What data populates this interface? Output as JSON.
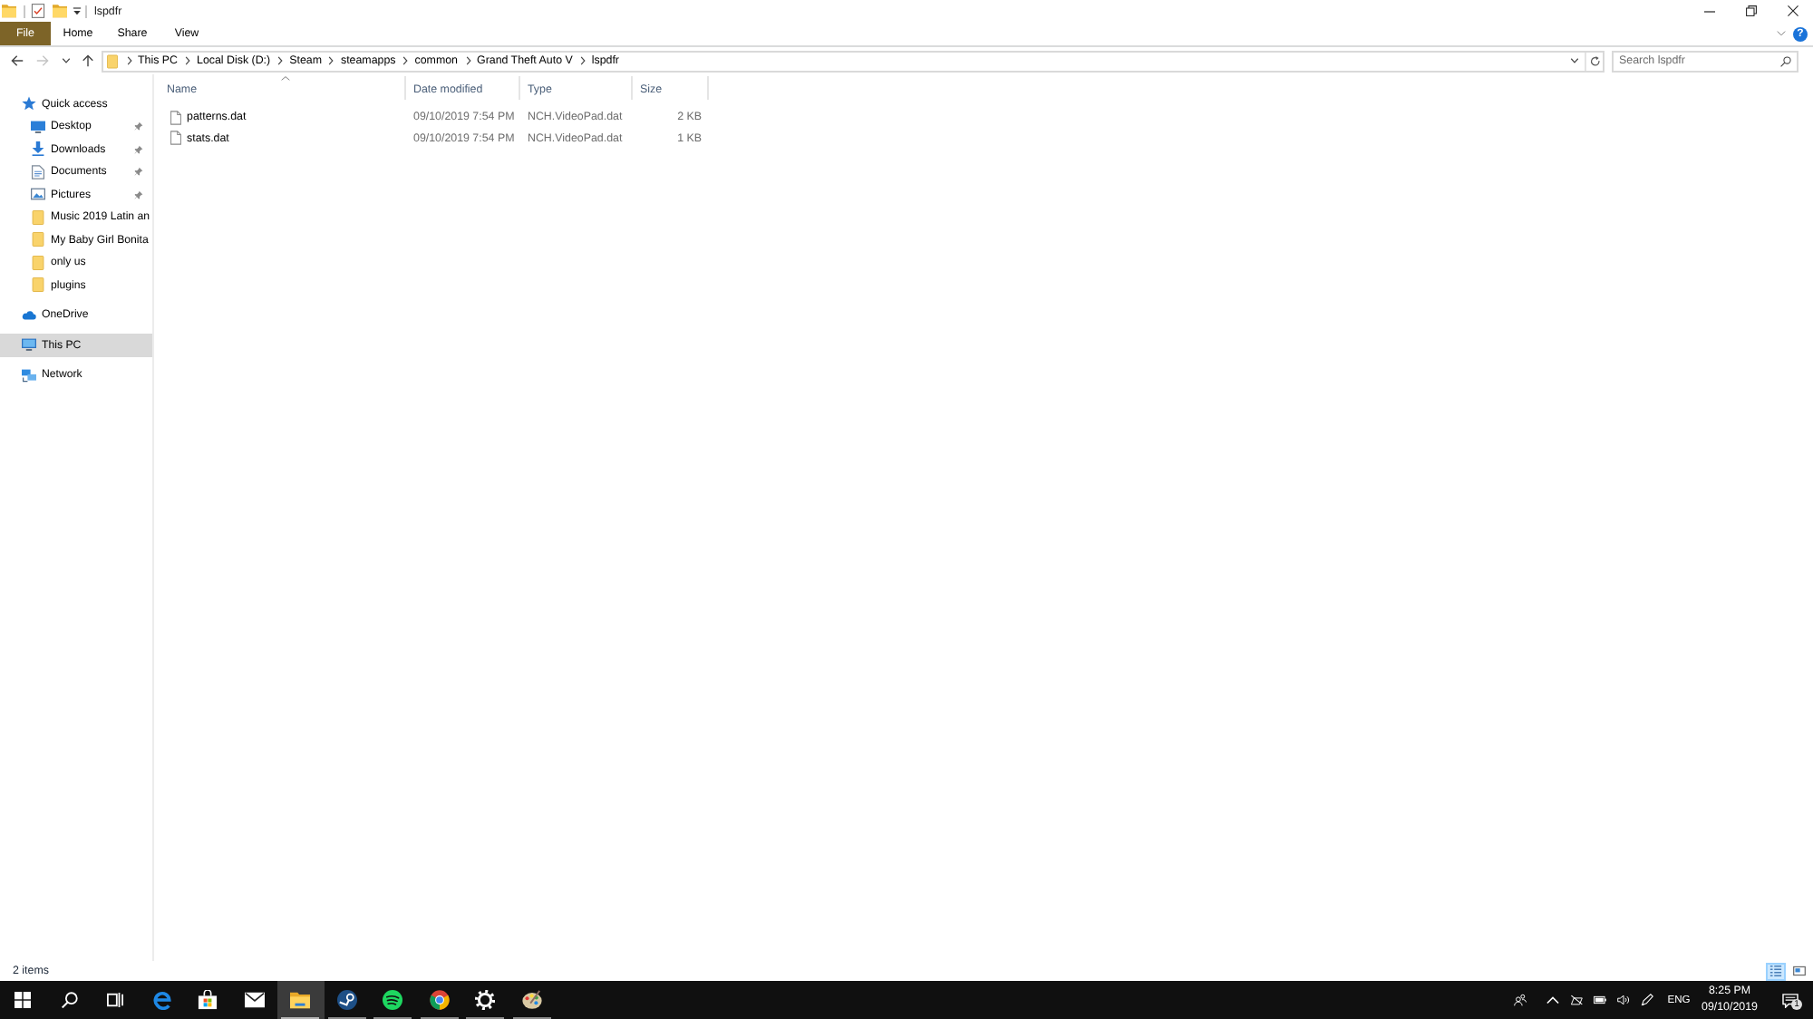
{
  "title_bar": {
    "title": "lspdfr"
  },
  "ribbon": {
    "tabs": [
      {
        "label": "File",
        "kind": "file",
        "selected": false
      },
      {
        "label": "Home",
        "kind": "tab",
        "selected": false
      },
      {
        "label": "Share",
        "kind": "tab",
        "selected": false
      },
      {
        "label": "View",
        "kind": "tab",
        "selected": false
      }
    ],
    "help": "?"
  },
  "navigation": {
    "buttons": [
      {
        "kind": "back",
        "disabled": false
      },
      {
        "kind": "forward",
        "disabled": true
      },
      {
        "kind": "recent",
        "disabled": false
      },
      {
        "kind": "up",
        "disabled": false
      }
    ]
  },
  "address_bar": {
    "path": [
      "This PC",
      "Local Disk (D:)",
      "Steam",
      "steamapps",
      "common",
      "Grand Theft Auto V",
      "lspdfr"
    ]
  },
  "search": {
    "placeholder": "Search lspdfr"
  },
  "navigation_pane": {
    "items": [
      {
        "label": "Quick access",
        "kind": "quick-access",
        "pinned": false,
        "selected": false,
        "children": [
          {
            "label": "Desktop",
            "kind": "desktop",
            "pinned": true,
            "selected": false
          },
          {
            "label": "Downloads",
            "kind": "downloads",
            "pinned": true,
            "selected": false
          },
          {
            "label": "Documents",
            "kind": "documents",
            "pinned": true,
            "selected": false
          },
          {
            "label": "Pictures",
            "kind": "pictures",
            "pinned": true,
            "selected": false
          },
          {
            "label": "Music 2019 Latin an",
            "kind": "folder",
            "pinned": false,
            "selected": false
          },
          {
            "label": "My Baby Girl Bonita",
            "kind": "folder",
            "pinned": false,
            "selected": false
          },
          {
            "label": "only us",
            "kind": "folder",
            "pinned": false,
            "selected": false
          },
          {
            "label": "plugins",
            "kind": "folder",
            "pinned": false,
            "selected": false
          }
        ]
      },
      {
        "label": "OneDrive",
        "kind": "onedrive",
        "pinned": false,
        "selected": false
      },
      {
        "label": "This PC",
        "kind": "this-pc",
        "pinned": false,
        "selected": true
      },
      {
        "label": "Network",
        "kind": "network",
        "pinned": false,
        "selected": false
      }
    ]
  },
  "file_list": {
    "columns": [
      {
        "label": "Name",
        "sorted": true
      },
      {
        "label": "Date modified",
        "sorted": false
      },
      {
        "label": "Type",
        "sorted": false
      },
      {
        "label": "Size",
        "sorted": false
      }
    ],
    "rows": [
      {
        "name": "patterns.dat",
        "date_modified": "09/10/2019 7:54 PM",
        "type": "NCH.VideoPad.dat",
        "size": "2 KB"
      },
      {
        "name": "stats.dat",
        "date_modified": "09/10/2019 7:54 PM",
        "type": "NCH.VideoPad.dat",
        "size": "1 KB"
      }
    ]
  },
  "status_bar": {
    "item_count": "2 items",
    "views": [
      {
        "kind": "details",
        "selected": true
      },
      {
        "kind": "large-icons",
        "selected": false
      }
    ]
  },
  "taskbar": {
    "buttons": [
      {
        "kind": "start",
        "active": false,
        "running": false
      },
      {
        "kind": "search",
        "active": false,
        "running": false
      },
      {
        "kind": "task-view",
        "active": false,
        "running": false
      },
      {
        "kind": "browser",
        "active": false,
        "running": false
      },
      {
        "kind": "store",
        "active": false,
        "running": false
      },
      {
        "kind": "mail",
        "active": false,
        "running": false
      },
      {
        "kind": "files",
        "active": true,
        "running": true
      },
      {
        "kind": "game",
        "active": false,
        "running": true
      },
      {
        "kind": "music",
        "active": false,
        "running": true
      },
      {
        "kind": "web",
        "active": false,
        "running": true
      },
      {
        "kind": "settings",
        "active": false,
        "running": true
      },
      {
        "kind": "paint",
        "active": false,
        "running": true
      }
    ],
    "tray_icons": [
      {
        "kind": "people"
      },
      {
        "kind": "chevron"
      },
      {
        "kind": "crossed"
      },
      {
        "kind": "battery"
      },
      {
        "kind": "speaker"
      },
      {
        "kind": "pen"
      }
    ],
    "language": "ENG",
    "time": "8:25 PM",
    "date": "09/10/2019",
    "notification_count": "1"
  }
}
